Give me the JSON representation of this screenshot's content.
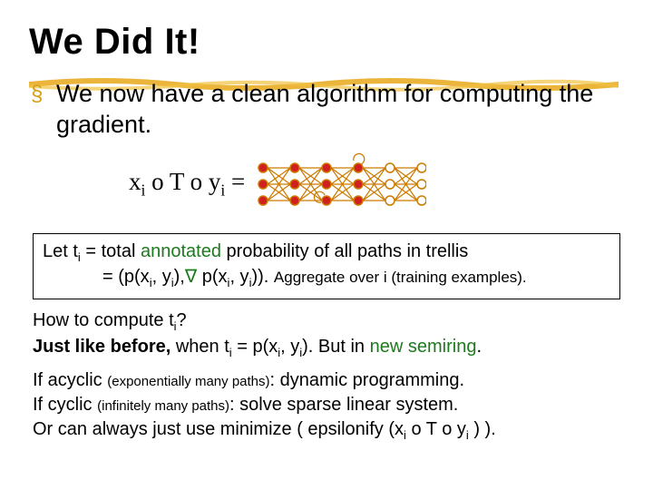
{
  "title": "We Did It!",
  "bullet": "We now have a clean algorithm for computing the gradient.",
  "formula": {
    "text_html": "x<sub class='sub'>i</sub> o T o y<sub class='sub'>i</sub> ="
  },
  "box": {
    "line1_pre": "Let t",
    "line1_sub": "i",
    "line1_mid": " = total ",
    "line1_annotated": "annotated",
    "line1_post": " probability of all paths in trellis",
    "line2_pre": "= (p(x",
    "line2_s1": "i",
    "line2_m1": ", y",
    "line2_s2": "i",
    "line2_m2": "),",
    "line2_nabla": "∇",
    "line2_m3": " p(x",
    "line2_s3": "i",
    "line2_m4": ", y",
    "line2_s4": "i",
    "line2_m5": ")).",
    "line2_tail": "Aggregate over i (training examples)."
  },
  "para1": {
    "q_pre": "How to compute t",
    "q_sub": "i",
    "q_post": "?",
    "a_bold": "Just like before,",
    "a_mid_pre": " when t",
    "a_mid_sub1": "i",
    "a_mid_mid": " = p(x",
    "a_mid_sub2": "i",
    "a_mid_mid2": ", y",
    "a_mid_sub3": "i",
    "a_mid_post": ").  But in ",
    "a_green": "new semiring",
    "a_end": "."
  },
  "final": {
    "l1_pre": "If acyclic ",
    "l1_note": "(exponentially many paths)",
    "l1_post": ": dynamic programming.",
    "l2_pre": "If cyclic ",
    "l2_note": "(infinitely many paths)",
    "l2_post": ": solve sparse linear system.",
    "l3_pre": "Or can always just use minimize ( epsilonify (x",
    "l3_s1": "i",
    "l3_mid": " o T o y",
    "l3_s2": "i",
    "l3_post": " ) )."
  }
}
